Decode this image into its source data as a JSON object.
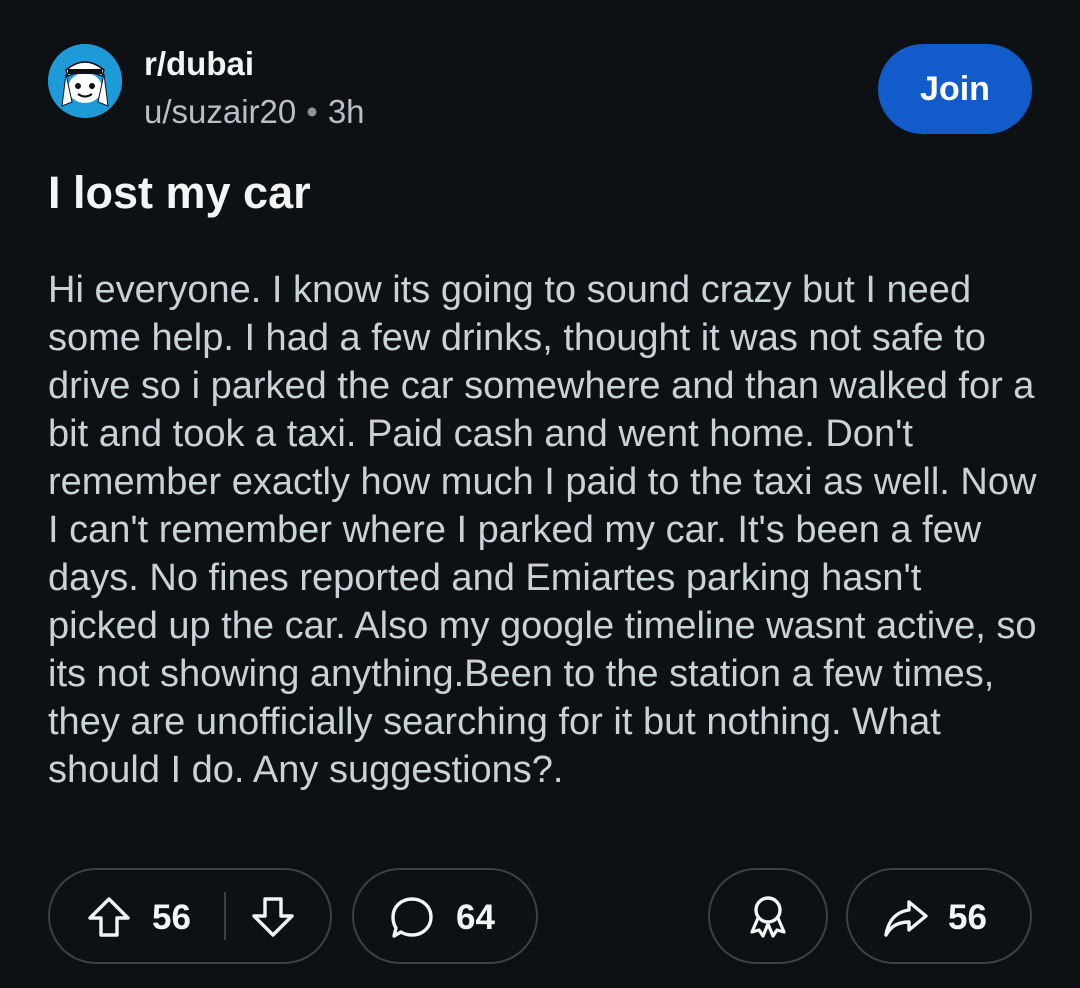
{
  "post": {
    "subreddit": "r/dubai",
    "author": "u/suzair20",
    "separator": "•",
    "age": "3h",
    "join_label": "Join",
    "title": "I lost my car",
    "body": "Hi everyone. I know its going to sound crazy but I need some help. I had a few drinks, thought it was not safe to drive so i parked the car somewhere and than walked for a bit and took a taxi. Paid cash and went home. Don't remember exactly how much I paid to the taxi as well. Now I can't remember where I parked my car. It's been a few days. No fines reported and Emiartes parking hasn't picked up the car. Also my google timeline wasnt active, so its not showing anything.Been to the station a few times, they are unofficially searching for it but nothing. What should I do. Any suggestions?."
  },
  "actions": {
    "upvotes": "56",
    "comments": "64",
    "shares": "56"
  },
  "icons": {
    "avatar": "subreddit-snoo-icon",
    "upvote": "arrow-up-icon",
    "downvote": "arrow-down-icon",
    "comment": "speech-bubble-icon",
    "award": "award-ribbon-icon",
    "share": "share-arrow-icon"
  },
  "colors": {
    "background": "#0e1113",
    "join_button": "#115bca",
    "avatar_bg": "#1d9bd8",
    "body_text": "#c9d2d7",
    "muted_text": "#b7c0c6"
  }
}
